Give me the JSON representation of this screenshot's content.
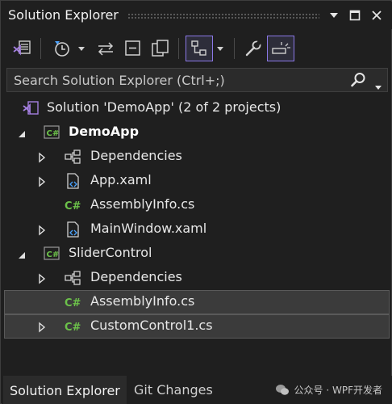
{
  "window": {
    "title": "Solution Explorer"
  },
  "toolbar": {
    "buttons": [
      {
        "icon": "vs-switch-views-icon"
      },
      {
        "icon": "history-clock-icon"
      },
      {
        "icon": "sync-arrows-icon"
      },
      {
        "icon": "collapse-all-icon"
      },
      {
        "icon": "copy-pages-icon"
      },
      {
        "icon": "show-all-files-icon",
        "active": true
      },
      {
        "icon": "properties-wrench-icon"
      },
      {
        "icon": "preview-selected-icon",
        "active": true
      }
    ]
  },
  "search": {
    "placeholder": "Search Solution Explorer (Ctrl+;)"
  },
  "tree": {
    "solution": "Solution 'DemoApp' (2 of 2 projects)",
    "items": [
      {
        "label": "DemoApp",
        "kind": "project"
      },
      {
        "label": "Dependencies",
        "kind": "dependencies"
      },
      {
        "label": "App.xaml",
        "kind": "xaml"
      },
      {
        "label": "AssemblyInfo.cs",
        "kind": "cs"
      },
      {
        "label": "MainWindow.xaml",
        "kind": "xaml"
      },
      {
        "label": "SliderControl",
        "kind": "project"
      },
      {
        "label": "Dependencies",
        "kind": "dependencies"
      },
      {
        "label": "AssemblyInfo.cs",
        "kind": "cs",
        "selected": true
      },
      {
        "label": "CustomControl1.cs",
        "kind": "cs",
        "selected": true
      }
    ]
  },
  "tabs": [
    {
      "label": "Solution Explorer",
      "active": true
    },
    {
      "label": "Git Changes",
      "active": false
    }
  ],
  "watermark": "公众号 · WPF开发者",
  "colors": {
    "background": "#1f1f1f",
    "accent": "#8b78e6",
    "csharp": "#6cc24a",
    "vs_purple": "#a47fe0"
  }
}
